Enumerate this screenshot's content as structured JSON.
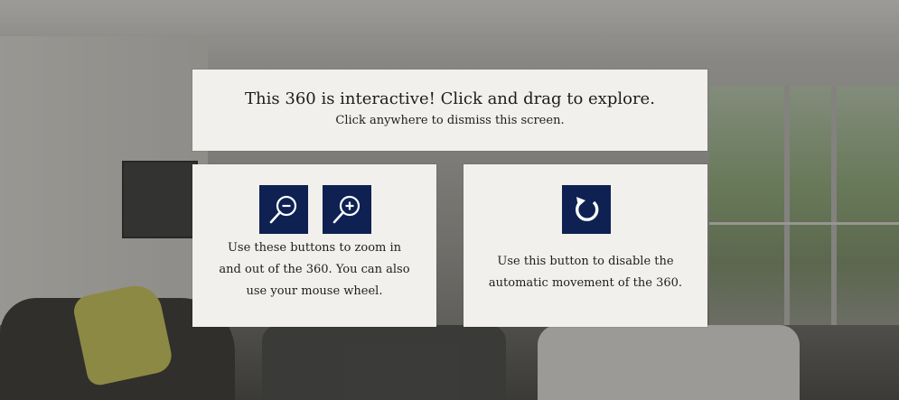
{
  "intro": {
    "title": "This 360 is interactive! Click and drag to explore.",
    "subtitle": "Click anywhere to dismiss this screen."
  },
  "zoom_panel": {
    "description": [
      "Use these buttons to zoom in",
      "and out of the 360. You can also",
      "use your mouse wheel."
    ],
    "buttons": [
      {
        "name": "zoom-out",
        "icon": "zoom-out-icon"
      },
      {
        "name": "zoom-in",
        "icon": "zoom-in-icon"
      }
    ]
  },
  "rotate_panel": {
    "description": [
      "Use this button to disable the",
      "automatic movement of the 360."
    ],
    "button": {
      "name": "auto-rotate-toggle",
      "icon": "rotate-icon"
    }
  },
  "colors": {
    "panel_bg": "#f1f0ec",
    "button_bg": "#0e2152",
    "text": "#1d1d1d"
  }
}
